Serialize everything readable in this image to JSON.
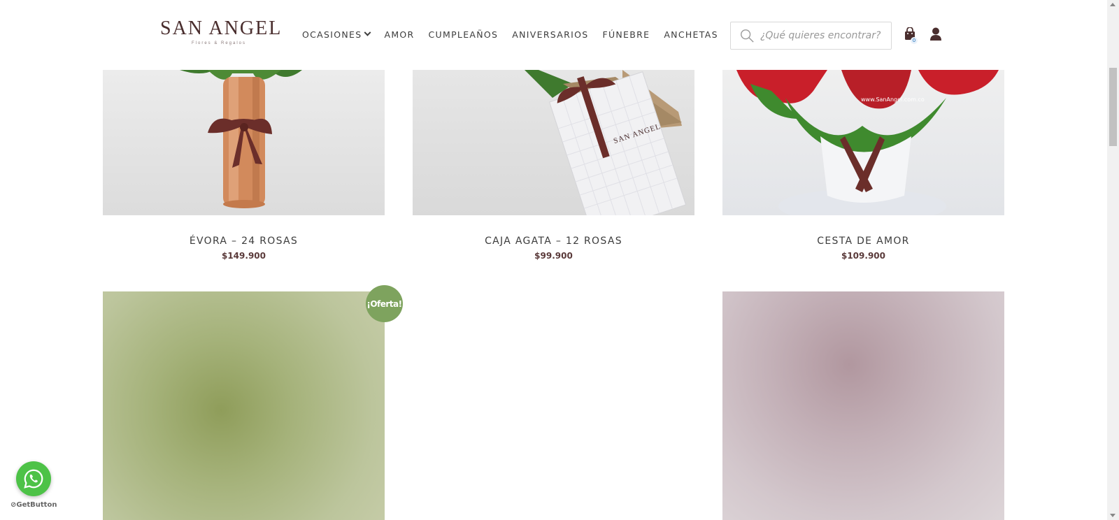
{
  "brand": {
    "name": "SAN ANGEL",
    "tagline": "Flores & Regalos"
  },
  "nav": {
    "items": [
      {
        "label": "OCASIONES",
        "has_dropdown": true
      },
      {
        "label": "AMOR"
      },
      {
        "label": "CUMPLEAÑOS"
      },
      {
        "label": "ANIVERSARIOS"
      },
      {
        "label": "FÚNEBRE"
      },
      {
        "label": "ANCHETAS"
      }
    ]
  },
  "search": {
    "placeholder": "¿Qué quieres encontrar?"
  },
  "cart": {
    "count": "0"
  },
  "products": [
    {
      "name": "ÉVORA – 24 ROSAS",
      "price": "$149.900"
    },
    {
      "name": "CAJA AGATA – 12 ROSAS",
      "price": "$99.900"
    },
    {
      "name": "CESTA DE AMOR",
      "price": "$109.900"
    }
  ],
  "badge": {
    "label": "¡Oferta!"
  },
  "widget": {
    "label": "GetButton"
  },
  "colors": {
    "brand": "#4a2e2e",
    "badge": "#7ea35e",
    "whatsapp": "#4dc247",
    "ribbon": "#6b2e2a"
  }
}
